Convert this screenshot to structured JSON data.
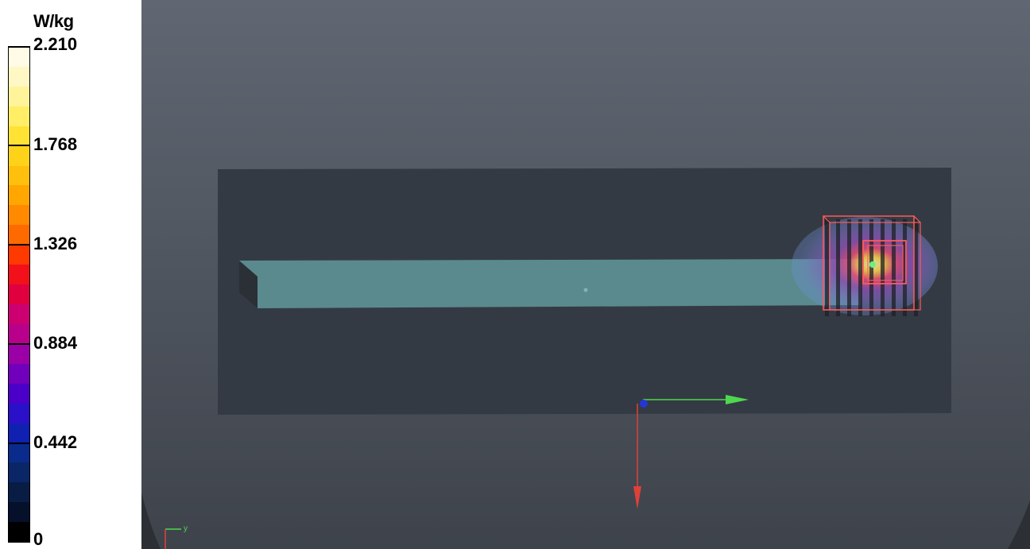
{
  "legend": {
    "unit": "W/kg",
    "tick_labels": [
      "2.210",
      "1.768",
      "1.326",
      "0.884",
      "0.442",
      "0"
    ],
    "swatches": [
      "#fffbe6",
      "#fff8c4",
      "#fff49a",
      "#ffee66",
      "#ffe233",
      "#ffd21a",
      "#ffbf0d",
      "#ffa600",
      "#ff8a00",
      "#ff6a00",
      "#ff3a00",
      "#f2101a",
      "#e00040",
      "#cc0070",
      "#b8008c",
      "#9a00a6",
      "#7000bb",
      "#4a00c8",
      "#2a10c8",
      "#1020b0",
      "#0a2a8c",
      "#0a2666",
      "#081c44",
      "#05102a",
      "#000000"
    ]
  },
  "viewport": {
    "background_top": "#606772",
    "background_bottom": "#3e434b",
    "phantom_color": "#343a43",
    "device_color": "#5a8a8e",
    "hotspot_colors": [
      "#6e8fd6",
      "#8a4fb0",
      "#e84d7a",
      "#ffd84a",
      "#fffbd0"
    ],
    "probe_box_color": "#ff5a5a",
    "axes": {
      "x_color": "#e0403a",
      "y_color": "#4ed84e",
      "z_color": "#2436d8",
      "mini_label": "y"
    }
  }
}
